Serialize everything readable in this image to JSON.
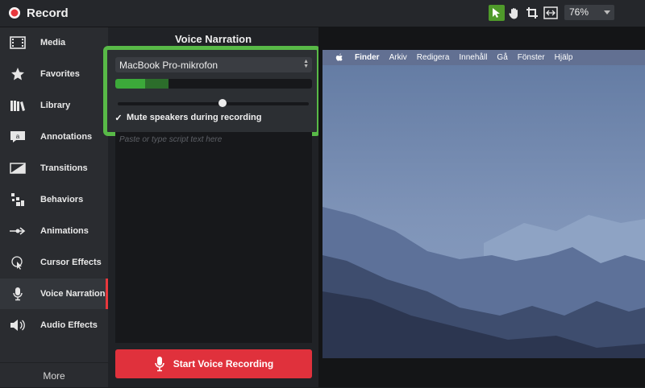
{
  "app": {
    "title": "Record",
    "zoom": "76%"
  },
  "toolbar": {
    "tools": [
      "pointer-tool",
      "pan-tool",
      "crop-tool",
      "fit-tool"
    ]
  },
  "sidebar": {
    "items": [
      {
        "label": "Media",
        "icon": "film-icon"
      },
      {
        "label": "Favorites",
        "icon": "star-icon"
      },
      {
        "label": "Library",
        "icon": "books-icon"
      },
      {
        "label": "Annotations",
        "icon": "annotation-icon"
      },
      {
        "label": "Transitions",
        "icon": "transition-icon"
      },
      {
        "label": "Behaviors",
        "icon": "behaviors-icon"
      },
      {
        "label": "Animations",
        "icon": "animation-arrow-icon"
      },
      {
        "label": "Cursor Effects",
        "icon": "cursor-effects-icon"
      },
      {
        "label": "Voice Narration",
        "icon": "microphone-icon",
        "active": true
      },
      {
        "label": "Audio Effects",
        "icon": "speaker-icon"
      }
    ],
    "more_label": "More"
  },
  "narration": {
    "title": "Voice Narration",
    "microphone": "MacBook Pro-mikrofon",
    "input_level": 0.15,
    "input_peak": 0.27,
    "volume": 0.55,
    "mute_checked": true,
    "mute_label": "Mute speakers during recording",
    "script_placeholder": "Paste or type script text here",
    "start_label": "Start Voice Recording"
  },
  "preview": {
    "menubar": [
      "Finder",
      "Arkiv",
      "Redigera",
      "Innehåll",
      "Gå",
      "Fönster",
      "Hjälp"
    ]
  },
  "colors": {
    "accent_green": "#58b947",
    "record_red": "#e0313c",
    "active_tool": "#4f9a2a"
  }
}
